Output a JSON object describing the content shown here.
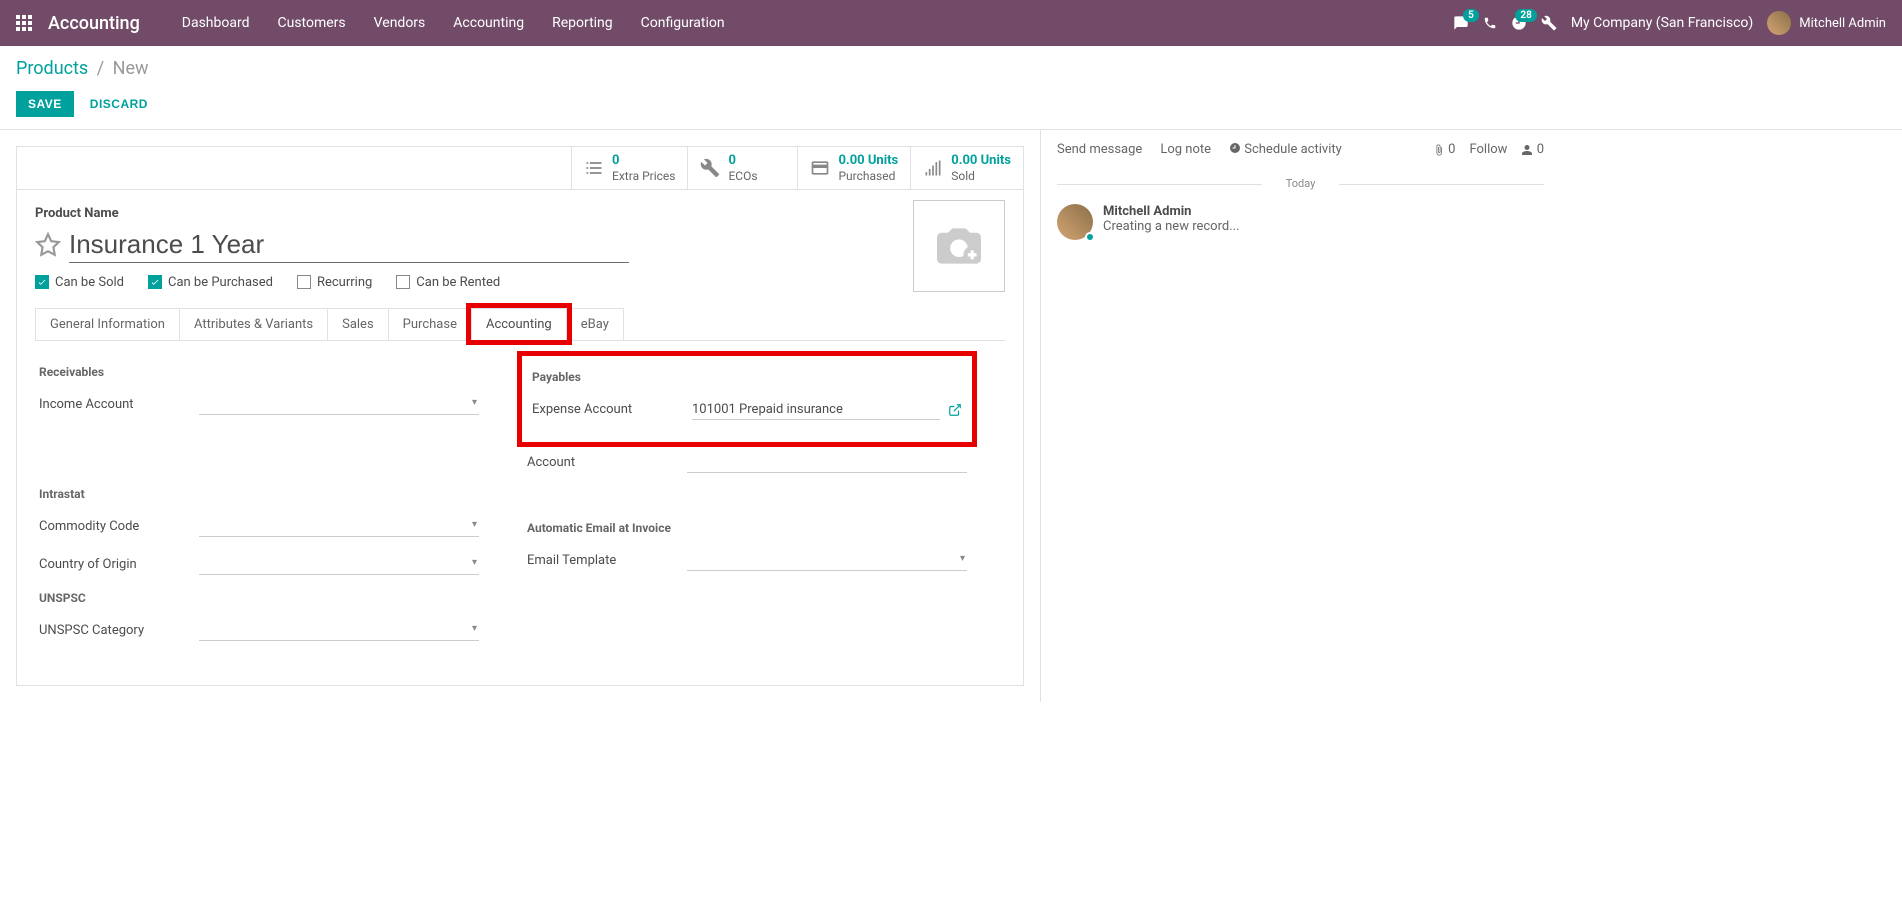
{
  "navbar": {
    "brand": "Accounting",
    "menu": [
      "Dashboard",
      "Customers",
      "Vendors",
      "Accounting",
      "Reporting",
      "Configuration"
    ],
    "badges": {
      "messages": "5",
      "activities": "28"
    },
    "company": "My Company (San Francisco)",
    "user": "Mitchell Admin"
  },
  "breadcrumb": {
    "link": "Products",
    "current": "New"
  },
  "buttons": {
    "save": "SAVE",
    "discard": "DISCARD"
  },
  "stats": [
    {
      "value": "0",
      "label": "Extra Prices"
    },
    {
      "value": "0",
      "label": "ECOs"
    },
    {
      "value": "0.00 Units",
      "label": "Purchased"
    },
    {
      "value": "0.00 Units",
      "label": "Sold"
    }
  ],
  "product": {
    "name_label": "Product Name",
    "name": "Insurance 1 Year",
    "checkboxes": [
      {
        "label": "Can be Sold",
        "checked": true
      },
      {
        "label": "Can be Purchased",
        "checked": true
      },
      {
        "label": "Recurring",
        "checked": false
      },
      {
        "label": "Can be Rented",
        "checked": false
      }
    ]
  },
  "tabs": [
    "General Information",
    "Attributes & Variants",
    "Sales",
    "Purchase",
    "Accounting",
    "eBay"
  ],
  "active_tab": "Accounting",
  "form": {
    "left": {
      "receivables_title": "Receivables",
      "income_account_label": "Income Account",
      "intrastat_title": "Intrastat",
      "commodity_code_label": "Commodity Code",
      "country_origin_label": "Country of Origin",
      "unspsc_title": "UNSPSC",
      "unspsc_category_label": "UNSPSC Category"
    },
    "right": {
      "payables_title": "Payables",
      "expense_account_label": "Expense Account",
      "expense_account_value": "101001 Prepaid insurance",
      "account_label": "Account",
      "auto_email_title": "Automatic Email at Invoice",
      "email_template_label": "Email Template"
    }
  },
  "chatter": {
    "send_message": "Send message",
    "log_note": "Log note",
    "schedule_activity": "Schedule activity",
    "attach_count": "0",
    "follow": "Follow",
    "follower_count": "0",
    "today": "Today",
    "msg_author": "Mitchell Admin",
    "msg_text": "Creating a new record..."
  }
}
